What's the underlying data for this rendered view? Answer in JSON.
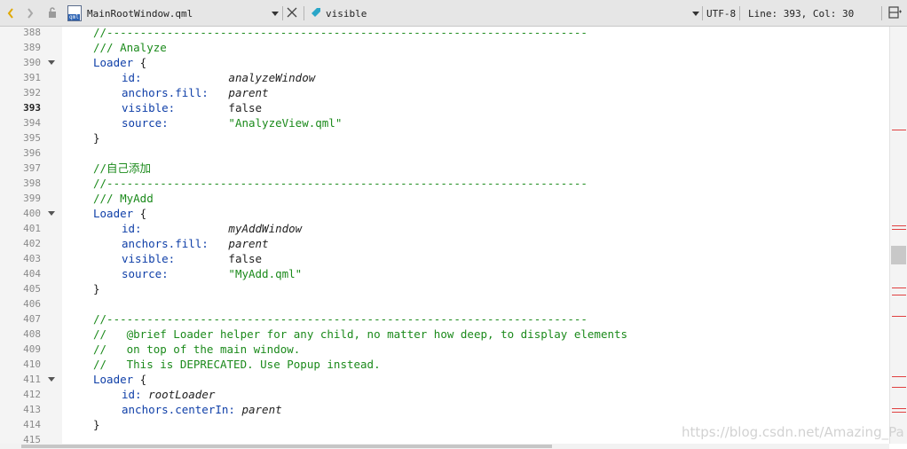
{
  "toolbar": {
    "file_name": "MainRootWindow.qml",
    "file_icon_text": "qml",
    "symbol_name": "visible",
    "encoding": "UTF-8",
    "cursor_position": "Line: 393, Col: 30"
  },
  "editor": {
    "current_line": "393",
    "lines": [
      {
        "num": "388",
        "fold": false,
        "indent": 0,
        "tokens": [
          {
            "c": "cm",
            "t": "//------------------------------------------------------------------------"
          }
        ]
      },
      {
        "num": "389",
        "fold": false,
        "indent": 0,
        "tokens": [
          {
            "c": "cm",
            "t": "/// Analyze"
          }
        ]
      },
      {
        "num": "390",
        "fold": true,
        "indent": 0,
        "tokens": [
          {
            "c": "kw",
            "t": "Loader"
          },
          {
            "c": "pl",
            "t": " {"
          }
        ]
      },
      {
        "num": "391",
        "fold": false,
        "indent": 1,
        "tokens": [
          {
            "c": "pr",
            "t": "id:"
          },
          {
            "c": "pl",
            "t": "             "
          },
          {
            "c": "it",
            "t": "analyzeWindow"
          }
        ]
      },
      {
        "num": "392",
        "fold": false,
        "indent": 1,
        "tokens": [
          {
            "c": "pr",
            "t": "anchors.fill:"
          },
          {
            "c": "pl",
            "t": "   "
          },
          {
            "c": "it",
            "t": "parent"
          }
        ]
      },
      {
        "num": "393",
        "fold": false,
        "indent": 1,
        "tokens": [
          {
            "c": "pr",
            "t": "visible:"
          },
          {
            "c": "pl",
            "t": "        false"
          }
        ]
      },
      {
        "num": "394",
        "fold": false,
        "indent": 1,
        "tokens": [
          {
            "c": "pr",
            "t": "source:"
          },
          {
            "c": "pl",
            "t": "         "
          },
          {
            "c": "str",
            "t": "\"AnalyzeView.qml\""
          }
        ]
      },
      {
        "num": "395",
        "fold": false,
        "indent": 0,
        "tokens": [
          {
            "c": "pl",
            "t": "}"
          }
        ]
      },
      {
        "num": "396",
        "fold": false,
        "indent": 0,
        "tokens": []
      },
      {
        "num": "397",
        "fold": false,
        "indent": 0,
        "tokens": [
          {
            "c": "cm",
            "t": "//自己添加"
          }
        ]
      },
      {
        "num": "398",
        "fold": false,
        "indent": 0,
        "tokens": [
          {
            "c": "cm",
            "t": "//------------------------------------------------------------------------"
          }
        ]
      },
      {
        "num": "399",
        "fold": false,
        "indent": 0,
        "tokens": [
          {
            "c": "cm",
            "t": "/// MyAdd"
          }
        ]
      },
      {
        "num": "400",
        "fold": true,
        "indent": 0,
        "tokens": [
          {
            "c": "kw",
            "t": "Loader"
          },
          {
            "c": "pl",
            "t": " {"
          }
        ]
      },
      {
        "num": "401",
        "fold": false,
        "indent": 1,
        "tokens": [
          {
            "c": "pr",
            "t": "id:"
          },
          {
            "c": "pl",
            "t": "             "
          },
          {
            "c": "it",
            "t": "myAddWindow"
          }
        ]
      },
      {
        "num": "402",
        "fold": false,
        "indent": 1,
        "tokens": [
          {
            "c": "pr",
            "t": "anchors.fill:"
          },
          {
            "c": "pl",
            "t": "   "
          },
          {
            "c": "it",
            "t": "parent"
          }
        ]
      },
      {
        "num": "403",
        "fold": false,
        "indent": 1,
        "tokens": [
          {
            "c": "pr",
            "t": "visible:"
          },
          {
            "c": "pl",
            "t": "        false"
          }
        ]
      },
      {
        "num": "404",
        "fold": false,
        "indent": 1,
        "tokens": [
          {
            "c": "pr",
            "t": "source:"
          },
          {
            "c": "pl",
            "t": "         "
          },
          {
            "c": "str",
            "t": "\"MyAdd.qml\""
          }
        ]
      },
      {
        "num": "405",
        "fold": false,
        "indent": 0,
        "tokens": [
          {
            "c": "pl",
            "t": "}"
          }
        ]
      },
      {
        "num": "406",
        "fold": false,
        "indent": 0,
        "tokens": []
      },
      {
        "num": "407",
        "fold": false,
        "indent": 0,
        "tokens": [
          {
            "c": "cm",
            "t": "//------------------------------------------------------------------------"
          }
        ]
      },
      {
        "num": "408",
        "fold": false,
        "indent": 0,
        "tokens": [
          {
            "c": "cm",
            "t": "//   @brief Loader helper for any child, no matter how deep, to display elements"
          }
        ]
      },
      {
        "num": "409",
        "fold": false,
        "indent": 0,
        "tokens": [
          {
            "c": "cm",
            "t": "//   on top of the main window."
          }
        ]
      },
      {
        "num": "410",
        "fold": false,
        "indent": 0,
        "tokens": [
          {
            "c": "cm",
            "t": "//   This is DEPRECATED. Use Popup instead."
          }
        ]
      },
      {
        "num": "411",
        "fold": true,
        "indent": 0,
        "tokens": [
          {
            "c": "kw",
            "t": "Loader"
          },
          {
            "c": "pl",
            "t": " {"
          }
        ]
      },
      {
        "num": "412",
        "fold": false,
        "indent": 1,
        "tokens": [
          {
            "c": "pr",
            "t": "id:"
          },
          {
            "c": "pl",
            "t": " "
          },
          {
            "c": "it",
            "t": "rootLoader"
          }
        ]
      },
      {
        "num": "413",
        "fold": false,
        "indent": 1,
        "tokens": [
          {
            "c": "pr",
            "t": "anchors.centerIn:"
          },
          {
            "c": "pl",
            "t": " "
          },
          {
            "c": "it",
            "t": "parent"
          }
        ]
      },
      {
        "num": "414",
        "fold": false,
        "indent": 0,
        "tokens": [
          {
            "c": "pl",
            "t": "}"
          }
        ]
      },
      {
        "num": "415",
        "fold": false,
        "indent": 0,
        "tokens": []
      }
    ]
  },
  "scrollbar": {
    "position_fraction": 0.55,
    "marker_count": 10
  },
  "watermark": "https://blog.csdn.net/Amazing_Pa",
  "colors": {
    "comment": "#1b8a1b",
    "keyword": "#0f3fa8",
    "string": "#1b8a1b",
    "marker": "#e04040",
    "symbol_icon": "#2aa6c8"
  },
  "icons": [
    "chevron-left-icon",
    "chevron-right-icon",
    "lock-icon",
    "qml-file-icon",
    "dropdown-icon",
    "close-icon",
    "tag-icon",
    "split-view-icon"
  ]
}
